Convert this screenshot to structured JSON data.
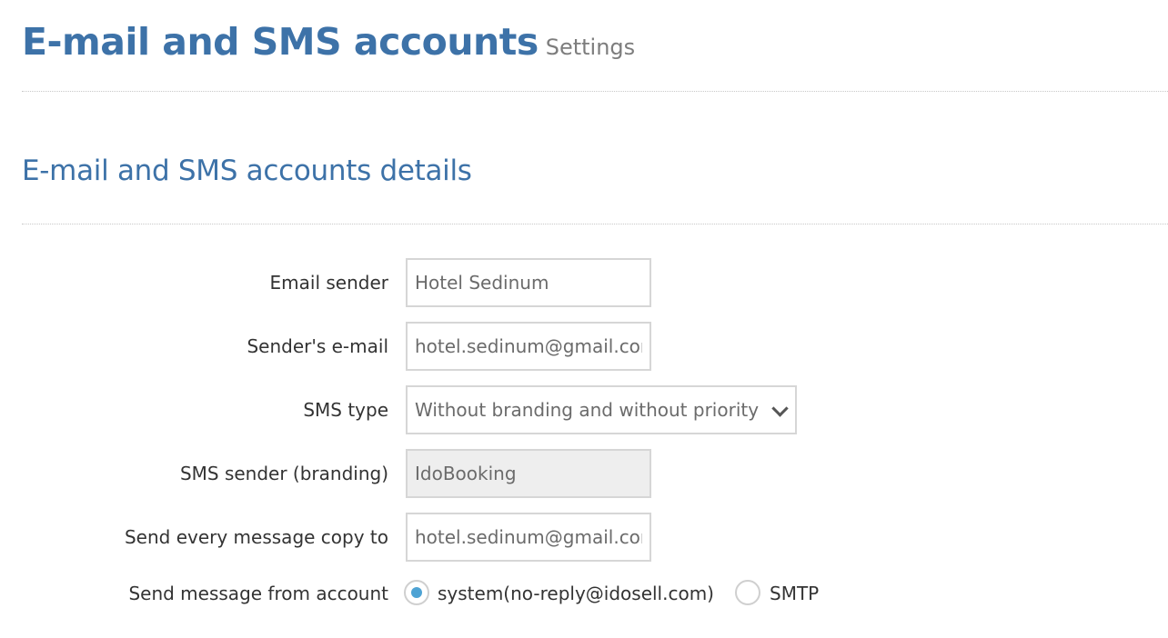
{
  "header": {
    "title": "E-mail and SMS accounts",
    "subtitle": "Settings"
  },
  "section": {
    "title": "E-mail and SMS accounts details"
  },
  "form": {
    "email_sender": {
      "label": "Email sender",
      "value": "Hotel Sedinum"
    },
    "sender_email": {
      "label": "Sender's e-mail",
      "value": "hotel.sedinum@gmail.com"
    },
    "sms_type": {
      "label": "SMS type",
      "value": "Without branding and without priority",
      "icon": "chevron-down-icon"
    },
    "sms_sender": {
      "label": "SMS sender (branding)",
      "value": "IdoBooking"
    },
    "copy_to": {
      "label": "Send every message copy to",
      "value": "hotel.sedinum@gmail.com"
    },
    "send_from": {
      "label": "Send message from account",
      "options": [
        {
          "label": "system(no-reply@idosell.com)",
          "checked": true
        },
        {
          "label": "SMTP",
          "checked": false
        }
      ]
    }
  },
  "colors": {
    "accent": "#3d72a8",
    "radio_selected": "#4ea3d4",
    "disabled_field": "#eeeeee"
  }
}
